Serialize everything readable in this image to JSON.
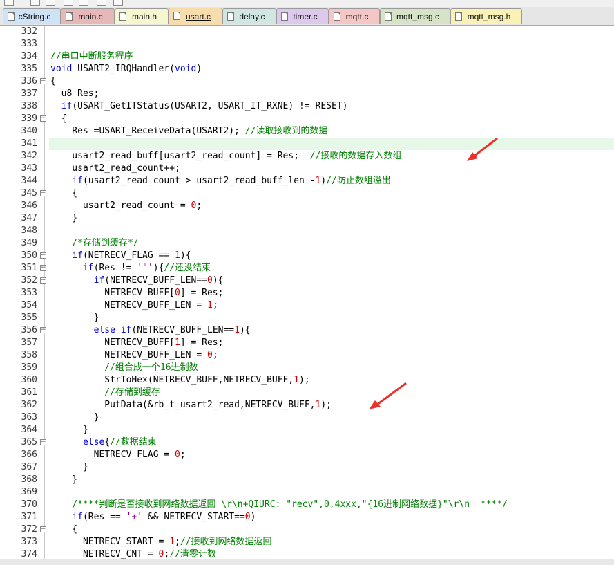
{
  "tabs": [
    {
      "label": "cString.c",
      "bg": "#cfe3f7",
      "active": false
    },
    {
      "label": "main.c",
      "bg": "#e6b8b8",
      "active": false
    },
    {
      "label": "main.h",
      "bg": "#f6f6d0",
      "active": false
    },
    {
      "label": "usart.c",
      "bg": "#f7dcae",
      "active": true
    },
    {
      "label": "delay.c",
      "bg": "#cfe7e0",
      "active": false
    },
    {
      "label": "timer.c",
      "bg": "#dcc9ec",
      "active": false
    },
    {
      "label": "mqtt.c",
      "bg": "#f4c6c6",
      "active": false
    },
    {
      "label": "mqtt_msg.c",
      "bg": "#d7e3c7",
      "active": false
    },
    {
      "label": "mqtt_msg.h",
      "bg": "#f9f1b5",
      "active": false
    }
  ],
  "colors": {
    "keyword": "#0000d0",
    "comment": "#008000",
    "number": "#d00000",
    "string": "#800080",
    "text": "#000000",
    "current_line": "#e6f9e8",
    "annotation_arrow": "#e8322a"
  },
  "code_lines": [
    {
      "n": "332",
      "fold": "",
      "code": ""
    },
    {
      "n": "333",
      "fold": "",
      "code": ""
    },
    {
      "n": "334",
      "fold": "",
      "code": "//串口中断服务程序"
    },
    {
      "n": "335",
      "fold": "",
      "code": "void USART2_IRQHandler(void)"
    },
    {
      "n": "336",
      "fold": "minus",
      "code": "{"
    },
    {
      "n": "337",
      "fold": "",
      "code": "  u8 Res;"
    },
    {
      "n": "338",
      "fold": "",
      "code": "  if(USART_GetITStatus(USART2, USART_IT_RXNE) != RESET)"
    },
    {
      "n": "339",
      "fold": "minus",
      "code": "  {"
    },
    {
      "n": "340",
      "fold": "",
      "code": "    Res =USART_ReceiveData(USART2); //读取接收到的数据"
    },
    {
      "n": "341",
      "fold": "",
      "code": "",
      "current": true
    },
    {
      "n": "342",
      "fold": "",
      "code": "    usart2_read_buff[usart2_read_count] = Res;  //接收的数据存入数组"
    },
    {
      "n": "343",
      "fold": "",
      "code": "    usart2_read_count++;"
    },
    {
      "n": "344",
      "fold": "",
      "code": "    if(usart2_read_count > usart2_read_buff_len -1)//防止数组溢出"
    },
    {
      "n": "345",
      "fold": "minus",
      "code": "    {"
    },
    {
      "n": "346",
      "fold": "",
      "code": "      usart2_read_count = 0;"
    },
    {
      "n": "347",
      "fold": "",
      "code": "    }"
    },
    {
      "n": "348",
      "fold": "",
      "code": ""
    },
    {
      "n": "349",
      "fold": "",
      "code": "    /*存储到缓存*/"
    },
    {
      "n": "350",
      "fold": "minus",
      "code": "    if(NETRECV_FLAG == 1){"
    },
    {
      "n": "351",
      "fold": "minus",
      "code": "      if(Res != '\"'){//还没结束"
    },
    {
      "n": "352",
      "fold": "minus",
      "code": "        if(NETRECV_BUFF_LEN==0){"
    },
    {
      "n": "353",
      "fold": "",
      "code": "          NETRECV_BUFF[0] = Res;"
    },
    {
      "n": "354",
      "fold": "",
      "code": "          NETRECV_BUFF_LEN = 1;"
    },
    {
      "n": "355",
      "fold": "",
      "code": "        }"
    },
    {
      "n": "356",
      "fold": "minus",
      "code": "        else if(NETRECV_BUFF_LEN==1){"
    },
    {
      "n": "357",
      "fold": "",
      "code": "          NETRECV_BUFF[1] = Res;"
    },
    {
      "n": "358",
      "fold": "",
      "code": "          NETRECV_BUFF_LEN = 0;"
    },
    {
      "n": "359",
      "fold": "",
      "code": "          //组合成一个16进制数"
    },
    {
      "n": "360",
      "fold": "",
      "code": "          StrToHex(NETRECV_BUFF,NETRECV_BUFF,1);"
    },
    {
      "n": "361",
      "fold": "",
      "code": "          //存储到缓存"
    },
    {
      "n": "362",
      "fold": "",
      "code": "          PutData(&rb_t_usart2_read,NETRECV_BUFF,1);"
    },
    {
      "n": "363",
      "fold": "",
      "code": "        }"
    },
    {
      "n": "364",
      "fold": "",
      "code": "      }"
    },
    {
      "n": "365",
      "fold": "minus",
      "code": "      else{//数据结束"
    },
    {
      "n": "366",
      "fold": "",
      "code": "        NETRECV_FLAG = 0;"
    },
    {
      "n": "367",
      "fold": "",
      "code": "      }"
    },
    {
      "n": "368",
      "fold": "",
      "code": "    }"
    },
    {
      "n": "369",
      "fold": "",
      "code": ""
    },
    {
      "n": "370",
      "fold": "",
      "code": "    /****判断是否接收到网络数据返回 \\r\\n+QIURC: \"recv\",0,4xxx,\"{16进制网络数据}\"\\r\\n  ****/"
    },
    {
      "n": "371",
      "fold": "",
      "code": "    if(Res == '+' && NETRECV_START==0)"
    },
    {
      "n": "372",
      "fold": "minus",
      "code": "    {"
    },
    {
      "n": "373",
      "fold": "",
      "code": "      NETRECV_START = 1;//接收到网络数据返回"
    },
    {
      "n": "374",
      "fold": "",
      "code": "      NETRECV_CNT = 0;//清零计数"
    }
  ]
}
